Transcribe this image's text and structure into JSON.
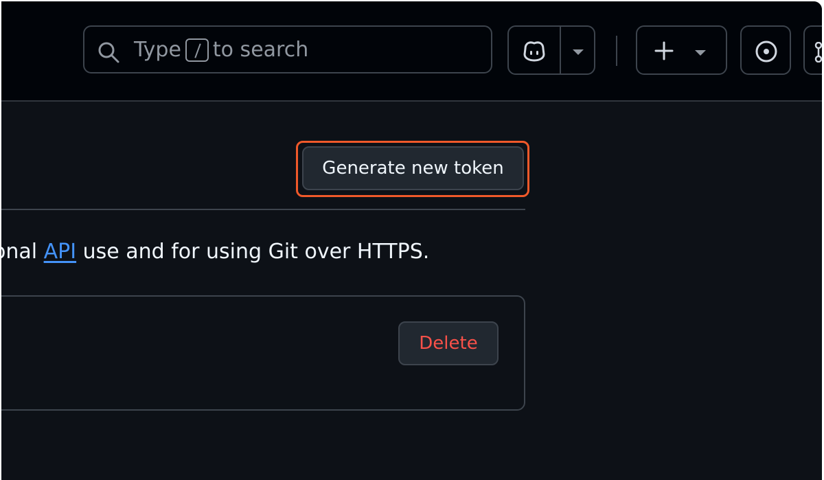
{
  "header": {
    "search": {
      "prefix": "Type",
      "kbd_hint": "/",
      "suffix": "to search"
    },
    "icons": {
      "search": "search-icon",
      "copilot": "copilot-icon",
      "create": "plus-icon",
      "issues": "issue-opened-icon",
      "pull_requests": "git-pull-request-icon"
    }
  },
  "main": {
    "generate_button_label": "Generate new token",
    "description": {
      "before_link": "onal ",
      "link": "API",
      "after_link": " use and for using Git over HTTPS."
    },
    "delete_button_label": "Delete"
  },
  "colors": {
    "background": "#0d1117",
    "header_background": "#010409",
    "border": "#3d444d",
    "highlight": "#f0592a",
    "link": "#4493f8",
    "danger": "#f85149"
  }
}
